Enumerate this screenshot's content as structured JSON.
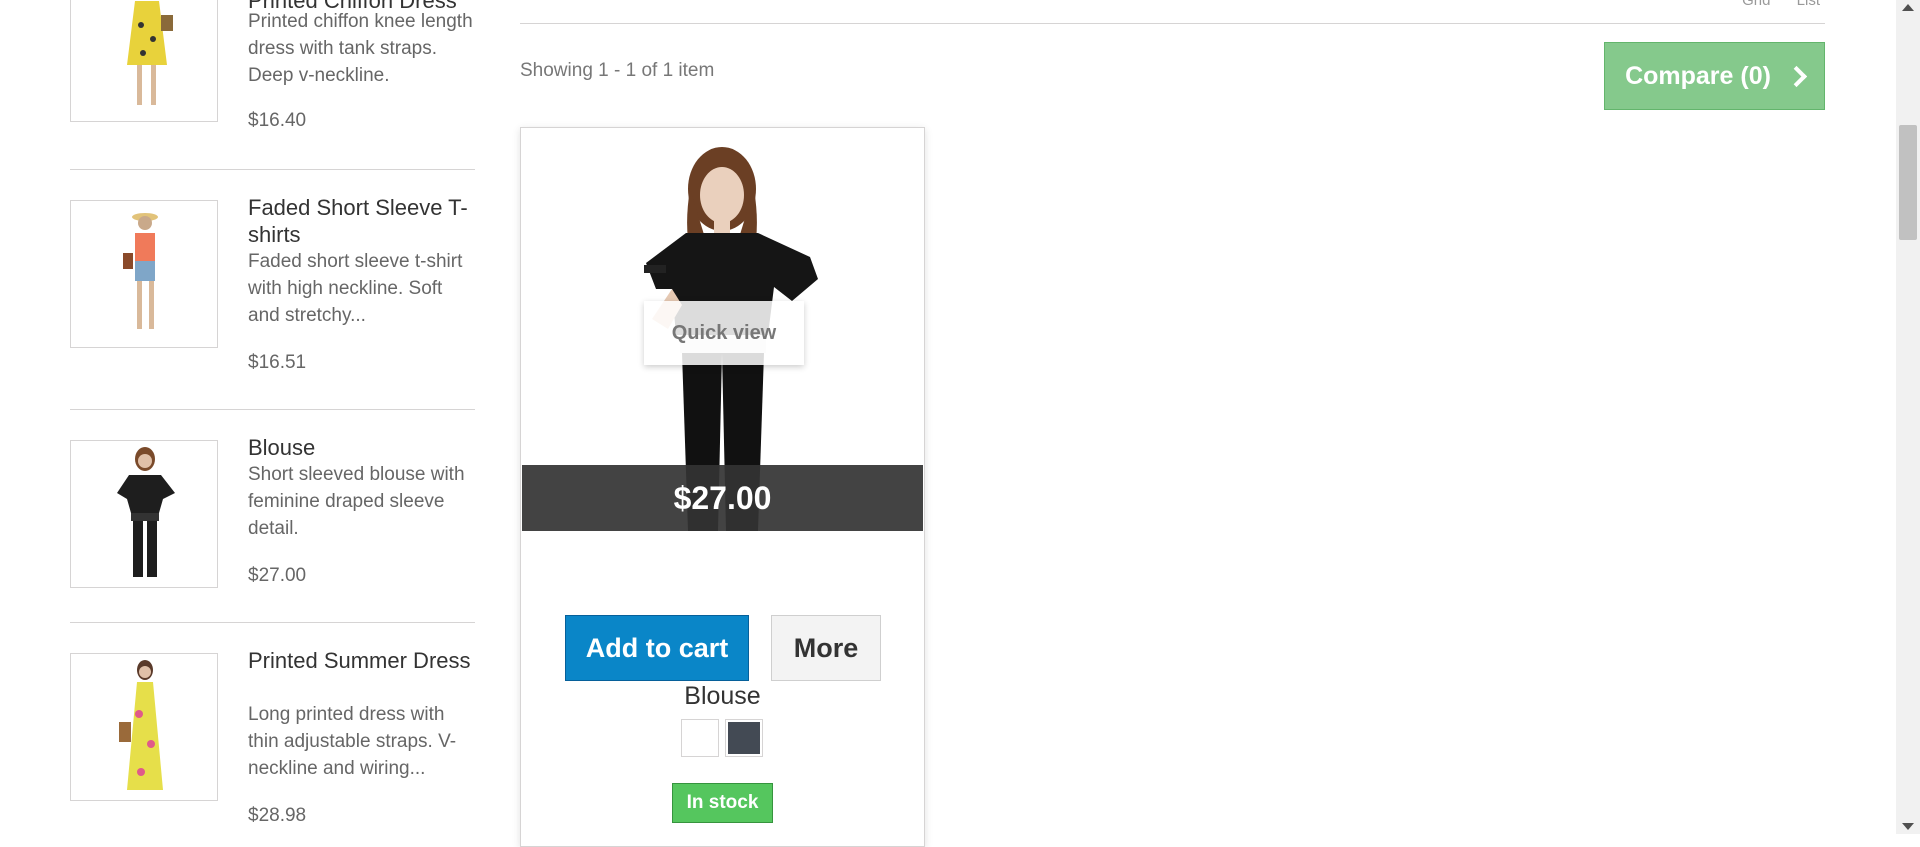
{
  "sidebar": {
    "items": [
      {
        "name": "Printed Chiffon Dress",
        "description": "Printed chiffon knee length dress with tank straps. Deep v-neckline.",
        "price": "$16.40",
        "image_icon": "yellow-dress-model-image"
      },
      {
        "name": "Faded Short Sleeve T-shirts",
        "description": "Faded short sleeve t-shirt with high neckline. Soft and stretchy...",
        "price": "$16.51",
        "image_icon": "orange-tshirt-model-image"
      },
      {
        "name": "Blouse",
        "description": "Short sleeved blouse with feminine draped sleeve detail.",
        "price": "$27.00",
        "image_icon": "black-blouse-model-image"
      },
      {
        "name": "Printed Summer Dress",
        "description": "Long printed dress with thin adjustable straps. V-neckline and wiring...",
        "price": "$28.98",
        "image_icon": "summer-dress-model-image"
      }
    ]
  },
  "toolbar": {
    "view_grid": "Grid",
    "view_list": "List",
    "showing": "Showing 1 - 1 of 1 item",
    "compare_label": "Compare (0)"
  },
  "product": {
    "price": "$27.00",
    "name": "Blouse",
    "quick_view": "Quick view",
    "add_to_cart": "Add to cart",
    "more": "More",
    "stock": "In stock",
    "colors": [
      "#ffffff",
      "#434a54"
    ]
  },
  "colors": {
    "compare_bg": "#85c98c",
    "cart_bg": "#0a86c8",
    "stock_bg": "#55c65e",
    "price_bar": "#333333"
  }
}
